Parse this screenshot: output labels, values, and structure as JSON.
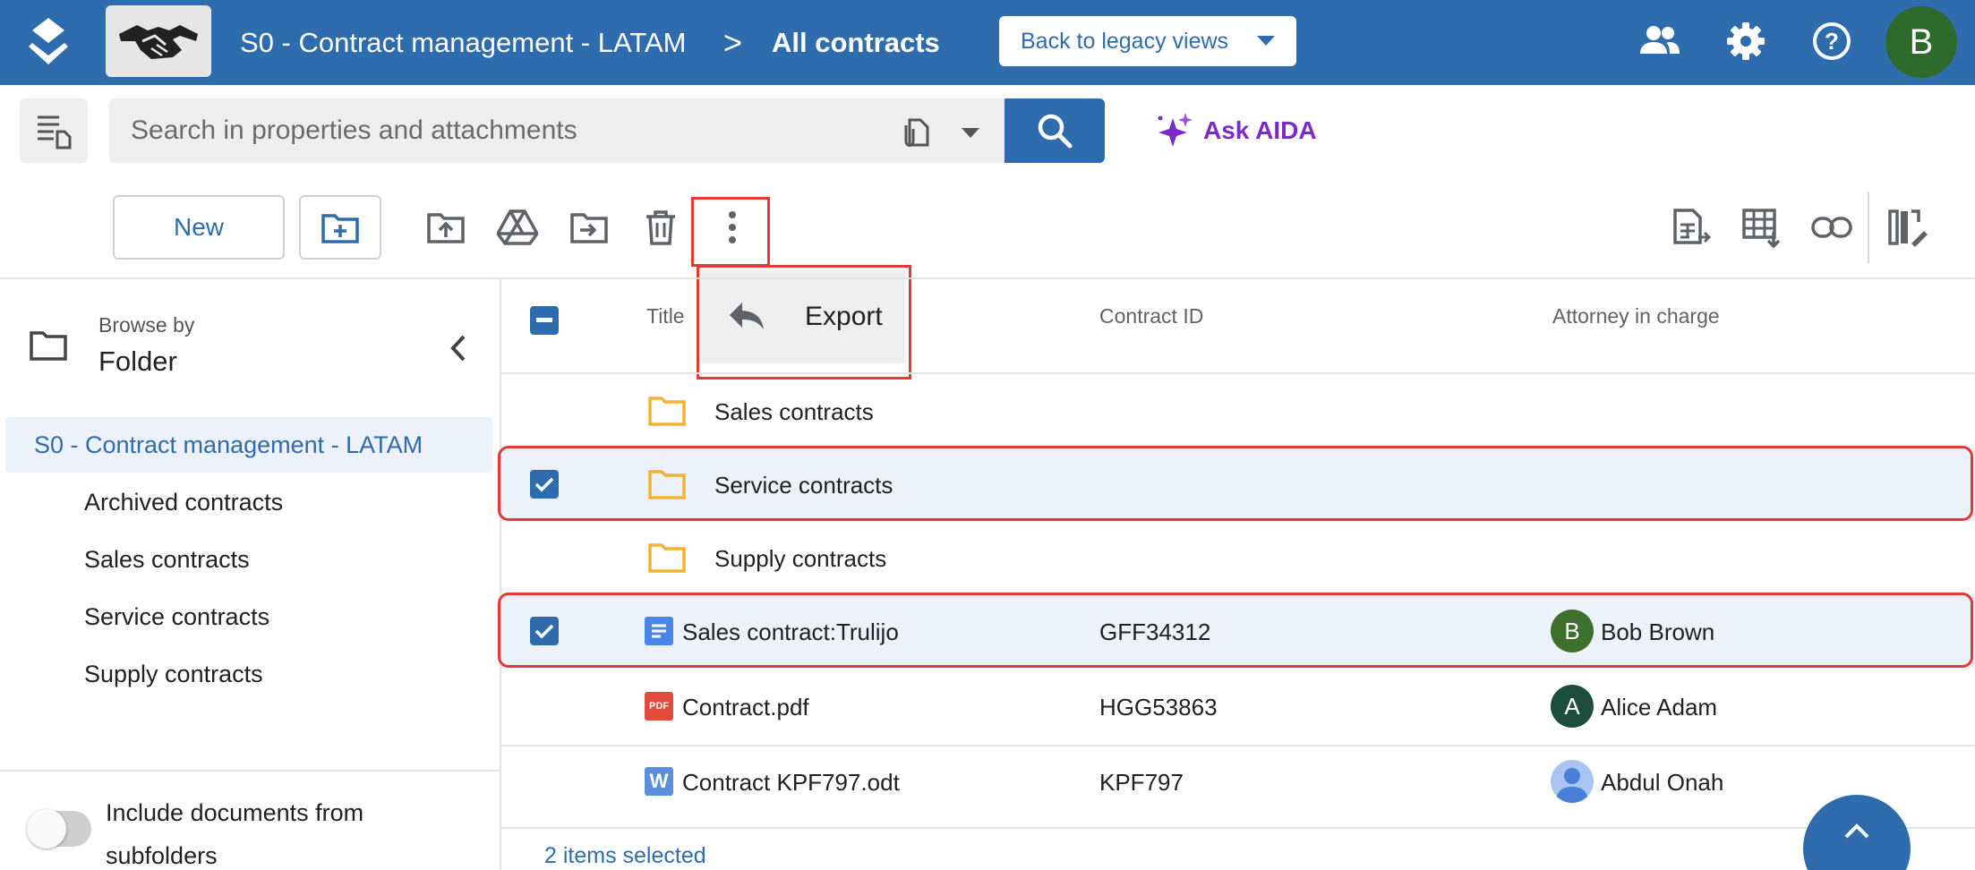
{
  "topbar": {
    "workspace_name": "S0 - Contract management - LATAM",
    "separator": ">",
    "current_view": "All contracts",
    "legacy_button": "Back to legacy views",
    "avatar_initial": "B",
    "icons": [
      "app-logo-icon",
      "handshake-logo",
      "people-icon",
      "gear-icon",
      "help-icon"
    ]
  },
  "search": {
    "placeholder": "Search in properties and attachments",
    "ask_aida": "Ask AIDA"
  },
  "toolbar": {
    "new_label": "New",
    "menu_item_export": "Export",
    "icons": [
      "new-folder-icon",
      "upload-icon",
      "google-drive-icon",
      "move-icon",
      "delete-icon",
      "more-vert-icon",
      "export-sheet-icon",
      "table-import-icon",
      "link-icon",
      "column-settings-icon"
    ]
  },
  "sidebar": {
    "browse_by": "Browse by",
    "browse_mode": "Folder",
    "root": "S0 - Contract management - LATAM",
    "items": [
      {
        "label": "Archived contracts"
      },
      {
        "label": "Sales contracts"
      },
      {
        "label": "Service contracts"
      },
      {
        "label": "Supply contracts"
      }
    ],
    "include_subfolders_line1": "Include documents from",
    "include_subfolders_line2": "subfolders",
    "include_subfolders_on": false
  },
  "table": {
    "headers": {
      "title": "Title",
      "contract_id": "Contract ID",
      "attorney": "Attorney in charge"
    },
    "rows": [
      {
        "type": "folder",
        "title": "Sales contracts",
        "contract_id": "",
        "attorney": "",
        "attorney_initial": "",
        "selected": false
      },
      {
        "type": "folder",
        "title": "Service contracts",
        "contract_id": "",
        "attorney": "",
        "attorney_initial": "",
        "selected": true
      },
      {
        "type": "folder",
        "title": "Supply contracts",
        "contract_id": "",
        "attorney": "",
        "attorney_initial": "",
        "selected": false
      },
      {
        "type": "gdoc",
        "title": "Sales contract:Trulijo",
        "contract_id": "GFF34312",
        "attorney": "Bob Brown",
        "attorney_initial": "B",
        "selected": true
      },
      {
        "type": "pdf",
        "title": "Contract.pdf",
        "contract_id": "HGG53863",
        "attorney": "Alice Adam",
        "attorney_initial": "A",
        "selected": false
      },
      {
        "type": "word",
        "title": "Contract KPF797.odt",
        "contract_id": "KPF797",
        "attorney": "Abdul Onah",
        "attorney_initial": "",
        "selected": false
      }
    ],
    "pdf_badge": "PDF",
    "word_badge": "W",
    "status": "2 items selected"
  },
  "colors": {
    "brand": "#2f6cae",
    "selected_row": "#edf1fa",
    "highlight": "#e53935",
    "aida": "#7b2ac7",
    "folder": "#f2b233"
  }
}
